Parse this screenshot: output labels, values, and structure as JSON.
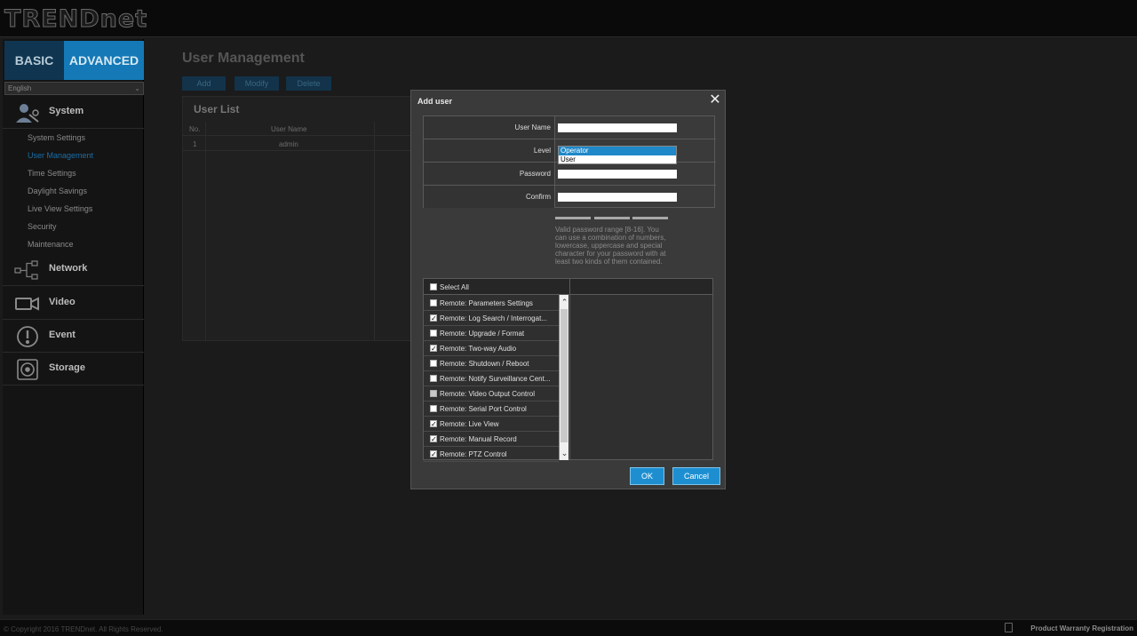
{
  "brand": {
    "logo": "TRENDnet"
  },
  "sidebar": {
    "mode_tabs": {
      "basic": "BASIC",
      "advanced": "ADVANCED"
    },
    "language": "English",
    "sections": [
      {
        "label": "System",
        "icon": "system-icon"
      },
      {
        "label": "Network",
        "icon": "network-icon"
      },
      {
        "label": "Video",
        "icon": "video-icon"
      },
      {
        "label": "Event",
        "icon": "event-icon"
      },
      {
        "label": "Storage",
        "icon": "storage-icon"
      }
    ],
    "system_items": [
      "System Settings",
      "User Management",
      "Time Settings",
      "Daylight Savings",
      "Live View Settings",
      "Security",
      "Maintenance"
    ],
    "active_item": "User Management"
  },
  "main": {
    "title": "User Management",
    "buttons": {
      "add": "Add",
      "modify": "Modify",
      "delete": "Delete"
    },
    "user_list": {
      "title": "User List",
      "columns": [
        "No.",
        "User Name"
      ],
      "rows": [
        {
          "no": "1",
          "user_name": "admin"
        }
      ]
    }
  },
  "dialog": {
    "title": "Add user",
    "fields": {
      "user_name_label": "User Name",
      "level_label": "Level",
      "password_label": "Password",
      "confirm_label": "Confirm"
    },
    "level_options": [
      "Operator",
      "User"
    ],
    "level_selected": "Operator",
    "password_note": "Valid password range [8-16]. You can use a combination of numbers, lowercase, uppercase and special character for your password with at least two kinds of them contained.",
    "select_all": "Select All",
    "permissions": [
      {
        "label": "Remote: Parameters Settings",
        "checked": false
      },
      {
        "label": "Remote: Log Search / Interrogat...",
        "checked": true
      },
      {
        "label": "Remote: Upgrade / Format",
        "checked": false
      },
      {
        "label": "Remote: Two-way Audio",
        "checked": true
      },
      {
        "label": "Remote: Shutdown / Reboot",
        "checked": false
      },
      {
        "label": "Remote: Notify Surveillance Cent...",
        "checked": false
      },
      {
        "label": "Remote: Video Output Control",
        "checked": false
      },
      {
        "label": "Remote: Serial Port Control",
        "checked": false
      },
      {
        "label": "Remote: Live View",
        "checked": true
      },
      {
        "label": "Remote: Manual Record",
        "checked": true
      },
      {
        "label": "Remote: PTZ Control",
        "checked": true
      }
    ],
    "ok": "OK",
    "cancel": "Cancel"
  },
  "footer": {
    "copyright": "© Copyright 2016 TRENDnet. All Rights Reserved.",
    "warranty": "Product Warranty Registration"
  },
  "colors": {
    "accent": "#1d8fd1",
    "active_link": "#1b6fa8"
  }
}
